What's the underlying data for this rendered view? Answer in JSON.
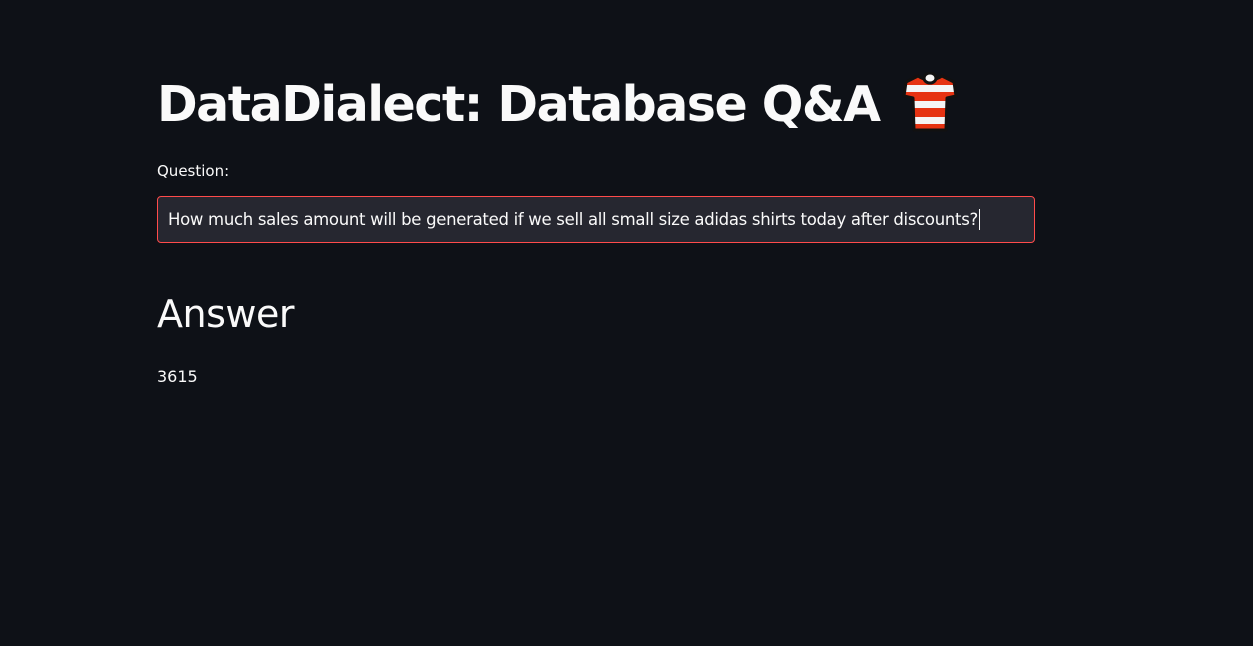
{
  "app": {
    "title": "DataDialect: Database Q&A",
    "title_icon": "t-shirt-icon"
  },
  "question": {
    "label": "Question:",
    "value": "How much sales amount will be generated if we sell all small size adidas shirts today after discounts?"
  },
  "answer": {
    "heading": "Answer",
    "value": "3615"
  },
  "colors": {
    "background": "#0e1117",
    "text": "#fafafa",
    "input_background": "#262730",
    "focus_border": "#ff4b4b"
  }
}
